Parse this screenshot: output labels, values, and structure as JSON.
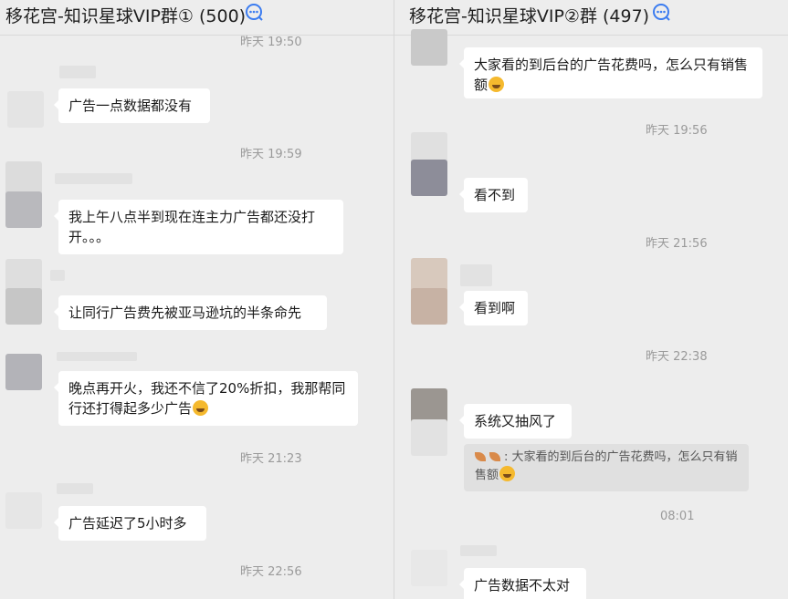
{
  "left": {
    "title": "移花宫-知识星球VIP群① (500)",
    "times": [
      "昨天 19:50",
      "昨天 19:59",
      "昨天 21:23",
      "昨天 22:56"
    ],
    "messages": [
      "广告一点数据都没有",
      "我上午八点半到现在连主力广告都还没打开。。。",
      "让同行广告费先被亚马逊坑的半条命先",
      "晚点再开火，我还不信了20%折扣，我那帮同行还打得起多少广告",
      "广告延迟了5小时多"
    ]
  },
  "right": {
    "title": "移花宫-知识星球VIP②群 (497)",
    "times": [
      "昨天 19:56",
      "昨天 21:56",
      "昨天 22:38",
      "08:01"
    ],
    "messages": [
      "大家看的到后台的广告花费吗，怎么只有销售额",
      "看不到",
      "看到啊",
      "系统又抽风了",
      "广告数据不太对"
    ],
    "quote": ": 大家看的到后台的广告花费吗，怎么只有销售额"
  },
  "colors": {
    "background": "#ededed",
    "bubble": "#ffffff",
    "quote_bg": "#e0e0e0",
    "accent": "#3b7cf0"
  }
}
